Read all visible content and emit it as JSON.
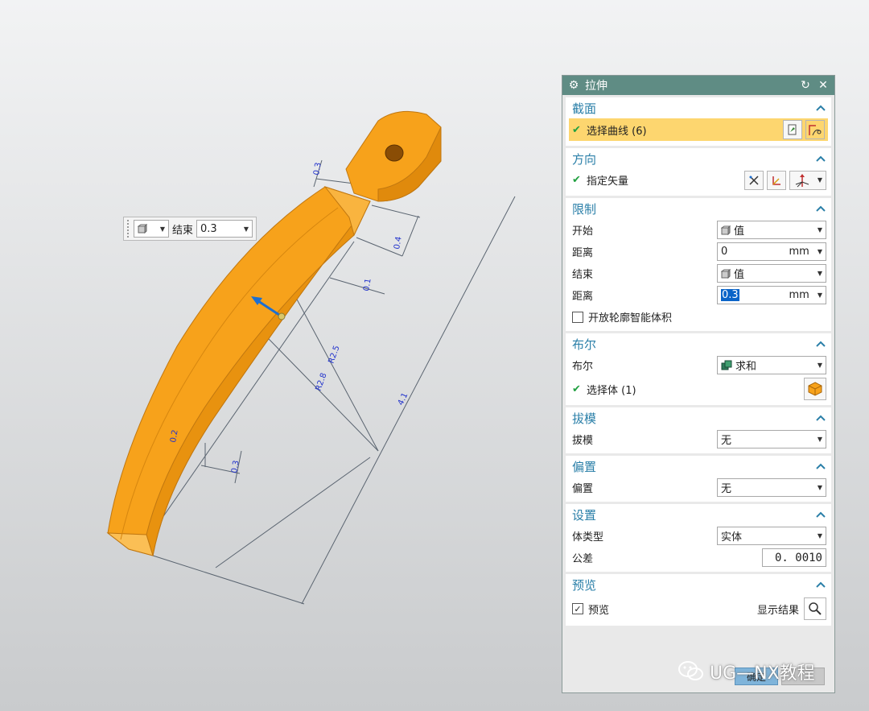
{
  "viewport": {
    "mini_toolbar": {
      "end_label": "结束",
      "end_value": "0.3"
    },
    "dimensions": [
      "0.3",
      "0.4",
      "0.1",
      "R2.5",
      "R2.8",
      "4.1",
      "0.2",
      "0.3"
    ]
  },
  "dialog": {
    "title": "拉伸",
    "section": {
      "title": "截面",
      "select_curve": "选择曲线 (6)"
    },
    "direction": {
      "title": "方向",
      "specify_vector": "指定矢量"
    },
    "limits": {
      "title": "限制",
      "start_label": "开始",
      "start_value": "值",
      "distance1_label": "距离",
      "distance1_value": "0",
      "distance1_unit": "mm",
      "end_label": "结束",
      "end_value": "值",
      "distance2_label": "距离",
      "distance2_value": "0.3",
      "distance2_unit": "mm",
      "open_profile_label": "开放轮廓智能体积",
      "open_profile_checked": false
    },
    "boolean": {
      "title": "布尔",
      "boolean_label": "布尔",
      "boolean_value": "求和",
      "select_body": "选择体 (1)"
    },
    "draft": {
      "title": "拔模",
      "label": "拔模",
      "value": "无"
    },
    "offset": {
      "title": "偏置",
      "label": "偏置",
      "value": "无"
    },
    "settings": {
      "title": "设置",
      "body_type_label": "体类型",
      "body_type_value": "实体",
      "tolerance_label": "公差",
      "tolerance_value": "0. 0010"
    },
    "preview": {
      "title": "预览",
      "preview_label": "预览",
      "preview_checked": true,
      "show_result_label": "显示结果"
    },
    "footer": {
      "ok_label": "确定",
      "cancel_label": ""
    }
  },
  "watermark": {
    "text": "UG—NX教程"
  },
  "colors": {
    "part": "#f7a21b",
    "title_bar": "#5f8c84",
    "section_title": "#2a7fa8",
    "highlight": "#fdd66f",
    "dimension": "#2233cc"
  }
}
